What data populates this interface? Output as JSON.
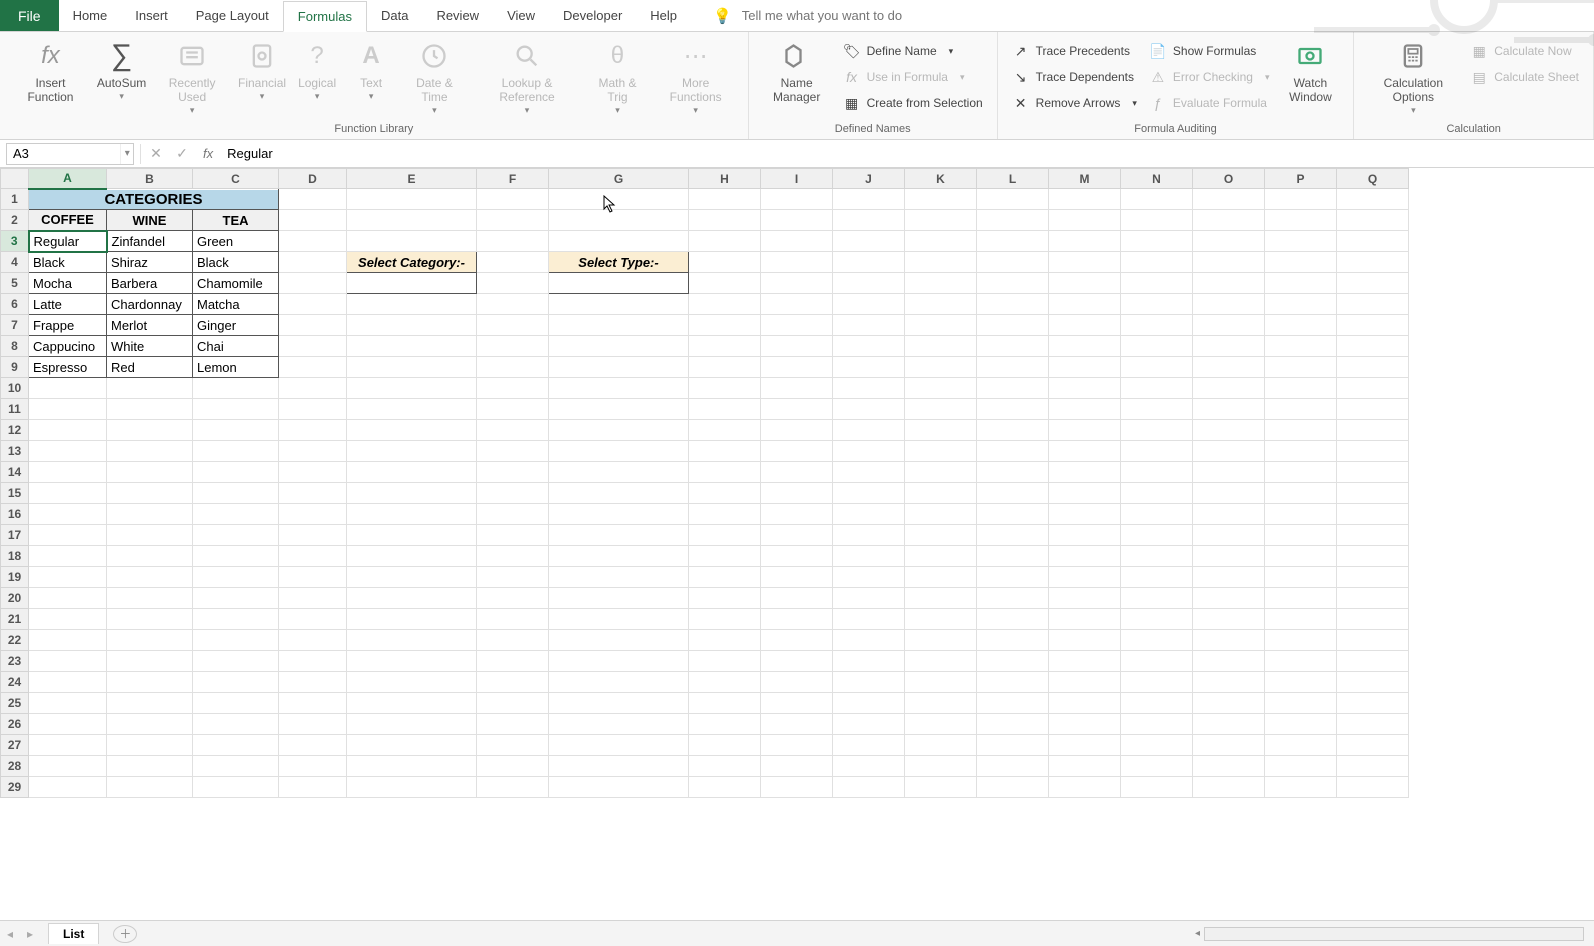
{
  "tabs": {
    "file": "File",
    "home": "Home",
    "insert": "Insert",
    "page_layout": "Page Layout",
    "formulas": "Formulas",
    "data": "Data",
    "review": "Review",
    "view": "View",
    "developer": "Developer",
    "help": "Help",
    "tellme_placeholder": "Tell me what you want to do"
  },
  "ribbon": {
    "func_lib": {
      "insert_function": "Insert\nFunction",
      "autosum": "AutoSum",
      "recently_used": "Recently\nUsed",
      "financial": "Financial",
      "logical": "Logical",
      "text": "Text",
      "date_time": "Date &\nTime",
      "lookup_ref": "Lookup &\nReference",
      "math_trig": "Math &\nTrig",
      "more_functions": "More\nFunctions",
      "group": "Function Library"
    },
    "defined_names": {
      "name_manager": "Name\nManager",
      "define_name": "Define Name",
      "use_in_formula": "Use in Formula",
      "create_from_sel": "Create from Selection",
      "group": "Defined Names"
    },
    "auditing": {
      "trace_prec": "Trace Precedents",
      "trace_dep": "Trace Dependents",
      "remove_arrows": "Remove Arrows",
      "show_formulas": "Show Formulas",
      "error_checking": "Error Checking",
      "evaluate": "Evaluate Formula",
      "watch_window": "Watch\nWindow",
      "group": "Formula Auditing"
    },
    "calc": {
      "calc_options": "Calculation\nOptions",
      "calc_now": "Calculate Now",
      "calc_sheet": "Calculate Sheet",
      "group": "Calculation"
    }
  },
  "name_box": "A3",
  "formula_bar": "Regular",
  "columns": [
    "A",
    "B",
    "C",
    "D",
    "E",
    "F",
    "G",
    "H",
    "I",
    "J",
    "K",
    "L",
    "M",
    "N",
    "O",
    "P",
    "Q"
  ],
  "rows_count": 29,
  "selected_col": "A",
  "selected_row": 3,
  "data": {
    "title": "CATEGORIES",
    "headers": [
      "COFFEE",
      "WINE",
      "TEA"
    ],
    "rows": [
      [
        "Regular",
        "Zinfandel",
        "Green"
      ],
      [
        "Black",
        "Shiraz",
        "Black"
      ],
      [
        "Mocha",
        "Barbera",
        "Chamomile"
      ],
      [
        "Latte",
        "Chardonnay",
        "Matcha"
      ],
      [
        "Frappe",
        "Merlot",
        "Ginger"
      ],
      [
        "Cappucino",
        "White",
        "Chai"
      ],
      [
        "Espresso",
        "Red",
        "Lemon"
      ]
    ],
    "select_category": "Select Category:-",
    "select_type": "Select Type:-"
  },
  "sheet_tab": "List"
}
